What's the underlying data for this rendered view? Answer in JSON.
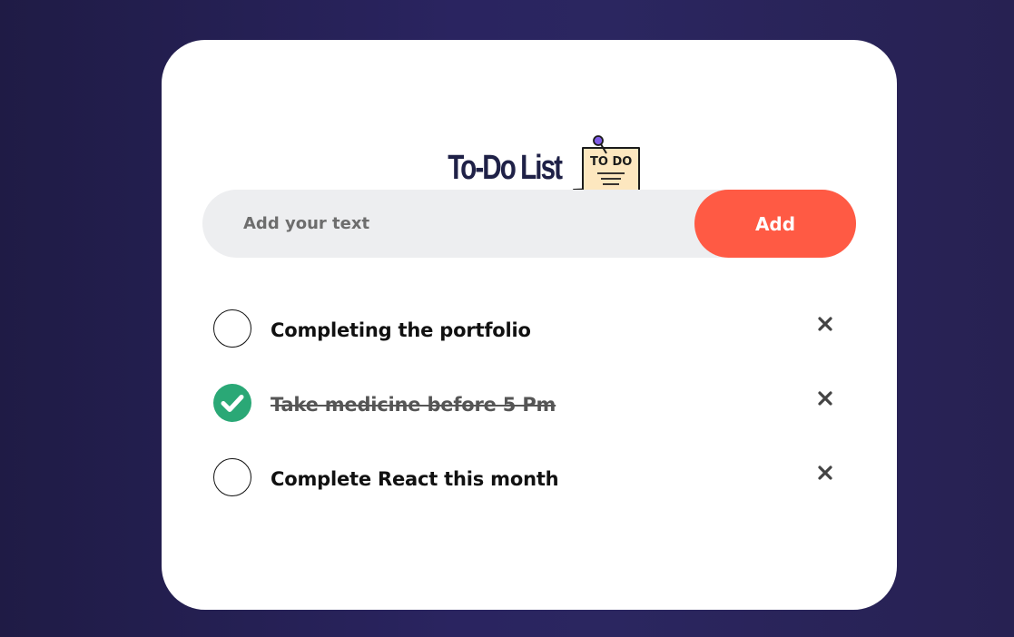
{
  "header": {
    "title": "To-Do List",
    "icon": "todo-note-icon",
    "icon_text": "TO DO"
  },
  "input": {
    "placeholder": "Add your text",
    "value": "",
    "add_label": "Add"
  },
  "tasks": [
    {
      "text": "Completing the portfolio",
      "done": false
    },
    {
      "text": "Take medicine before 5 Pm",
      "done": true
    },
    {
      "text": "Complete React this month",
      "done": false
    }
  ],
  "colors": {
    "accent": "#ff5a44",
    "check_done": "#2aa876",
    "title": "#1f2147",
    "background": "#2a2460"
  }
}
